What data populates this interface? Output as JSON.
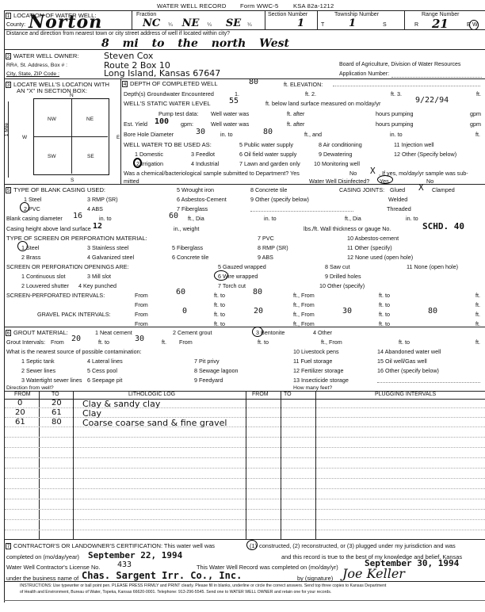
{
  "header": {
    "title": "WATER WELL RECORD",
    "form": "Form WWC-5",
    "ksa": "KSA 82a-1212"
  },
  "section1": {
    "num": "1",
    "label": "LOCATION OF WATER WELL:",
    "county_label": "County:",
    "county_value": "Norton",
    "fraction_label": "Fraction",
    "fraction_values": [
      "NC",
      "NE",
      "SE"
    ],
    "quarter": "¼",
    "section_number_label": "Section Number",
    "section_number_value": "1",
    "township_label": "Township Number",
    "township_t": "T",
    "township_value": "1",
    "township_s": "S",
    "range_label": "Range Number",
    "range_r": "R",
    "range_value": "21",
    "range_ew": "E",
    "range_ew_selected": "W",
    "distance_label": "Distance and direction from nearest town or city street address of well if located within city?",
    "distance_value": "8 mi to the north West"
  },
  "section2": {
    "num": "2",
    "label": "WATER WELL OWNER:",
    "owner": "Steven Cox",
    "address_label": "RR#, St. Address, Box # :",
    "address": "Route 2 Box 10",
    "city_label": "City, State, ZIP Code      :",
    "city": "Long Island, Kansas 67647",
    "board": "Board of Agriculture, Division of Water Resources",
    "application_label": "Application Number:"
  },
  "section3": {
    "num": "3",
    "label_line1": "LOCATE WELL'S LOCATION WITH",
    "label_line2": "AN \"X\" IN SECTION BOX:",
    "n": "N",
    "s": "S",
    "e": "E",
    "w": "W",
    "nw": "NW",
    "ne": "NE",
    "sw": "SW",
    "se": "SE",
    "mile": "1 Mile"
  },
  "section4": {
    "num": "4",
    "depth_label": "DEPTH OF COMPLETED WELL",
    "depth_value": "80",
    "ft_elevation": "ft. ELEVATION:",
    "groundwater_label": "Depth(s) Groundwater Encountered",
    "gw1": "1.",
    "gw2": "ft. 2.",
    "gw3": "ft. 3.",
    "gw_ft": "ft.",
    "static_label": "WELL'S STATIC WATER LEVEL",
    "static_value": "55",
    "static_below": "ft. below land surface measured on mo/day/yr",
    "static_date": "9/22/94",
    "pump_label": "Pump test data:",
    "well_water_was": "Well water was",
    "ft_after": "ft. after",
    "hours_pumping": "hours pumping",
    "gpm": "gpm",
    "yield_label": "Est. Yield",
    "yield_value": "100",
    "gpm_colon": "gpm:",
    "bore_label": "Bore Hole Diameter",
    "bore_value": "30",
    "in_to": "in. to",
    "bore_to_value": "80",
    "ft_and": "ft., and",
    "in_to2": "in. to",
    "ft": "ft.",
    "use_label": "WELL WATER TO BE USED AS:",
    "uses": [
      "1 Domestic",
      "2 Irrigation",
      "3 Feedlot",
      "4 Industrial",
      "5 Public water supply",
      "6 Oil field water supply",
      "7 Lawn and garden only",
      "8 Air conditioning",
      "9 Dewatering",
      "10 Monitoring well",
      "11 Injection well",
      "12 Other (Specify below)"
    ],
    "use_selected": "2 Irrigation",
    "sample_q": "Was a chemical/bacteriological sample submitted to Department? Yes",
    "sample_no": "No",
    "sample_mark": "X",
    "sample_if": ", If yes, mo/day/yr sample was sub-",
    "mitted": "mitted",
    "disinfected_label": "Water Well Disinfected?",
    "disinfected_yes": "Yes",
    "disinfected_no": "No",
    "disinfected_selected": "Yes"
  },
  "section5": {
    "num": "5",
    "casing_label": "TYPE OF BLANK CASING USED:",
    "casing_types": [
      "1 Steel",
      "2 PVC",
      "3 RMP (SR)",
      "4 ABS",
      "5 Wrought iron",
      "6 Asbestos-Cement",
      "7 Fiberglass",
      "8 Concrete tile",
      "9 Other (specify below)"
    ],
    "casing_selected": "2 PVC",
    "joints_label": "CASING JOINTS:",
    "joints_glued": "Glued",
    "joints_glued_mark": "X",
    "joints_clamped": "Clamped",
    "joints_welded": "Welded",
    "joints_threaded": "Threaded",
    "diameter_label": "Blank casing diameter",
    "diameter_value": "16",
    "in_to": "in. to",
    "diameter_to": "60",
    "ft_dia": "ft., Dia",
    "height_label": "Casing height above land surface",
    "height_value": "12",
    "in_weight": "in., weight",
    "lbs_ft": "lbs./ft. Wall thickness or gauge No.",
    "gauge_value": "SCHD. 40",
    "screen_label": "TYPE OF SCREEN OR PERFORATION MATERIAL:",
    "screen_types": [
      "1 Steel",
      "2 Brass",
      "3 Stainless steel",
      "4 Galvanized steel",
      "5 Fiberglass",
      "6 Concrete tile",
      "7 PVC",
      "8 RMP (SR)",
      "9 ABS",
      "10 Asbestos-cement",
      "11 Other (specify)",
      "12 None used (open hole)"
    ],
    "screen_selected": "1 Steel",
    "openings_label": "SCREEN OR PERFORATION OPENINGS ARE:",
    "openings": [
      "1 Continuous slot",
      "2 Louvered shutter",
      "3 Mill slot",
      "4 Key punched",
      "5 Gauzed wrapped",
      "6 Wire wrapped",
      "7 Torch cut",
      "8 Saw cut",
      "9 Drilled holes",
      "10 Other (specify)",
      "11 None (open hole)"
    ],
    "openings_selected": "6 Wire wrapped",
    "screen_intervals_label": "SCREEN-PERFORATED INTERVALS:",
    "from": "From",
    "ft_to": "ft. to",
    "ft_from": "ft., From",
    "ft": "ft.",
    "screen_from": "60",
    "screen_to": "80",
    "gravel_label": "GRAVEL PACK INTERVALS:",
    "gravel_from": "0",
    "gravel_to": "20",
    "gravel_from2": "30",
    "gravel_to2": "80"
  },
  "section6": {
    "num": "6",
    "grout_label": "GROUT MATERIAL:",
    "grout_types": [
      "1 Neat cement",
      "2 Cement grout",
      "3 Bentonite",
      "4 Other"
    ],
    "grout_selected": "3 Bentonite",
    "grout_intervals_label": "Grout Intervals:",
    "grout_from": "20",
    "grout_to": "30",
    "contamination_label": "What is the nearest source of possible contamination:",
    "contamination": [
      "1 Septic tank",
      "2 Sewer lines",
      "3 Watertight sewer lines",
      "4 Lateral lines",
      "5 Cess pool",
      "6 Seepage pit",
      "7 Pit privy",
      "8 Sewage lagoon",
      "9 Feedyard",
      "10 Livestock pens",
      "11 Fuel storage",
      "12 Fertilizer storage",
      "13 Insecticide storage",
      "14 Abandoned water well",
      "15 Oil well/Gas well",
      "16 Other (specify below)"
    ],
    "direction_label": "Direction from well?",
    "feet_label": "How many feet?"
  },
  "log_table": {
    "headers": [
      "FROM",
      "TO",
      "LITHOLOGIC LOG",
      "FROM",
      "TO",
      "PLUGGING INTERVALS"
    ],
    "rows": [
      {
        "from": "0",
        "to": "20",
        "log": "Clay & sandy clay"
      },
      {
        "from": "20",
        "to": "61",
        "log": "Clay"
      },
      {
        "from": "61",
        "to": "80",
        "log": "Coarse coarse sand & fine gravel"
      }
    ]
  },
  "section7": {
    "num": "7",
    "cert_line1a": "CONTRACTOR'S OR LANDOWNER'S CERTIFICATION: This water well was",
    "cert_opt1": "(1)",
    "cert_line1b": "constructed, (2) reconstructed, or (3) plugged under my jurisdiction and was",
    "completed_label": "completed on (mo/day/year)",
    "completed_value": "September 22, 1994",
    "true_text": "and this record is true to the best of my knowledge and belief. Kansas",
    "license_label": "Water Well Contractor's License No.",
    "license_value": "433",
    "record_completed": "This Water Well Record was completed on (mo/day/yr)",
    "record_date": "September 30, 1994",
    "business_label": "under the business name of",
    "business_value": "Chas. Sargent Irr. Co., Inc.",
    "signature_label": "by (signature)",
    "signature": "Joe Keller",
    "instructions1": "INSTRUCTIONS: Use typewriter or ball point pen. PLEASE PRESS FIRMLY and PRINT clearly. Please fill in blanks, underline or circle the correct answers. Send top three copies to Kansas Department",
    "instructions2": "of Health and Environment, Bureau of Water, Topeka, Kansas 66620-0001. Telephone: 913-296-5545. Send one to WATER WELL OWNER and retain one for your records."
  }
}
